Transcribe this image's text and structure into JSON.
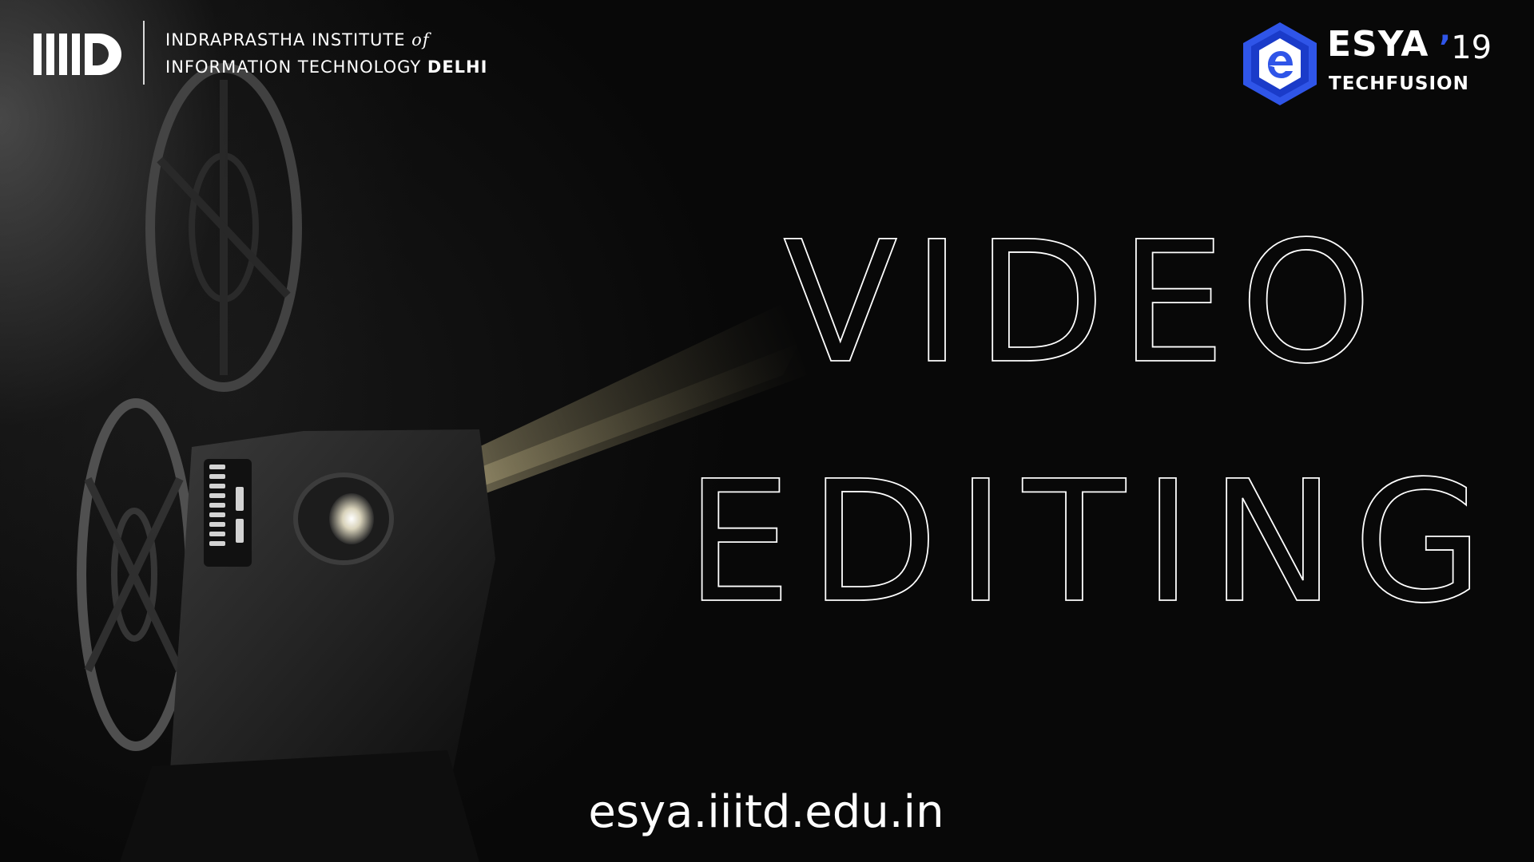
{
  "header": {
    "institute_line1_main": "INDRAPRASTHA INSTITUTE ",
    "institute_line1_italic": "of",
    "institute_line2_main": "INFORMATION TECHNOLOGY ",
    "institute_line2_bold": "DELHI",
    "logo_text": "IIITD"
  },
  "event_logo": {
    "name": "ESYA",
    "apostrophe": "’",
    "year": "19",
    "subtitle": "TECHFUSION",
    "brand_color": "#2f55e8"
  },
  "headline": {
    "line1": "VIDEO",
    "line2": "EDITING"
  },
  "footer": {
    "website": "esya.iiitd.edu.in"
  },
  "icons": [
    "iiitd-logo-icon",
    "esya-hex-icon",
    "film-projector-illustration"
  ]
}
